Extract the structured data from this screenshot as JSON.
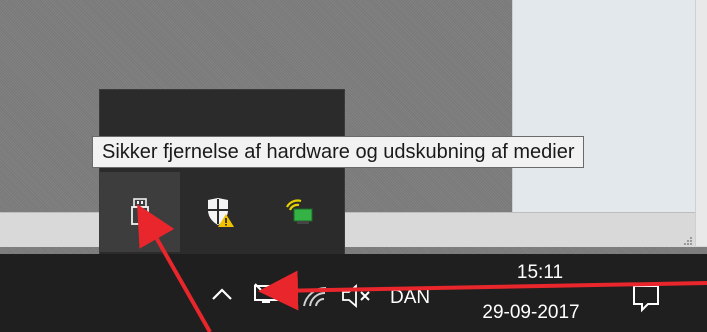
{
  "tooltip": {
    "text": "Sikker fjernelse af hardware og udskubning af medier"
  },
  "taskbar": {
    "language": "DAN",
    "time": "15:11",
    "date": "29-09-2017"
  },
  "tray_icons": [
    "nvidia-icon",
    "speaker-app-icon",
    "cloud-icon",
    "usb-eject-icon",
    "windows-defender-warning-icon",
    "network-status-icon"
  ],
  "taskbar_icons": [
    "show-hidden-icons-chevron",
    "network-monitor-icon",
    "wifi-icon",
    "volume-muted-icon",
    "action-center-icon"
  ],
  "colors": {
    "arrow": "#e8262b",
    "taskbar": "#1f1f1f",
    "flyout": "#2b2b2b"
  }
}
